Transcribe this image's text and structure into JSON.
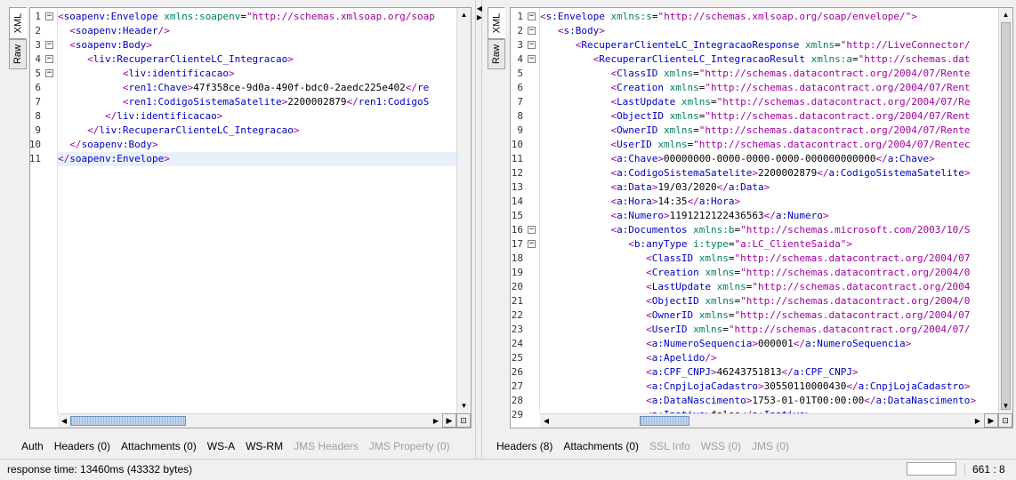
{
  "left": {
    "tabs": [
      "XML",
      "Raw"
    ],
    "active_tab": "XML",
    "lines": [
      {
        "n": "1",
        "fold": "−",
        "indent": 0,
        "seg": [
          [
            "br",
            "<"
          ],
          [
            "tag",
            "soapenv:Envelope"
          ],
          [
            "text",
            " "
          ],
          [
            "attr",
            "xmlns:soapenv"
          ],
          [
            "text",
            "="
          ],
          [
            "val",
            "\"http://schemas.xmlsoap.org/soap"
          ]
        ]
      },
      {
        "n": "2",
        "indent": 2,
        "seg": [
          [
            "br",
            "<"
          ],
          [
            "tag",
            "soapenv:Header"
          ],
          [
            "br",
            "/>"
          ]
        ]
      },
      {
        "n": "3",
        "fold": "−",
        "indent": 2,
        "seg": [
          [
            "br",
            "<"
          ],
          [
            "tag",
            "soapenv:Body"
          ],
          [
            "br",
            ">"
          ]
        ]
      },
      {
        "n": "4",
        "fold": "−",
        "indent": 5,
        "seg": [
          [
            "br",
            "<"
          ],
          [
            "tag",
            "liv:RecuperarClienteLC_Integracao"
          ],
          [
            "br",
            ">"
          ]
        ]
      },
      {
        "n": "5",
        "fold": "−",
        "indent": 11,
        "seg": [
          [
            "br",
            "<"
          ],
          [
            "tag",
            "liv:identificacao"
          ],
          [
            "br",
            ">"
          ]
        ]
      },
      {
        "n": "6",
        "indent": 11,
        "seg": [
          [
            "br",
            "<"
          ],
          [
            "tag",
            "ren1:Chave"
          ],
          [
            "br",
            ">"
          ],
          [
            "text",
            "47f358ce-9d0a-490f-bdc0-2aedc225e402"
          ],
          [
            "br",
            "</"
          ],
          [
            "tag",
            "re"
          ]
        ]
      },
      {
        "n": "7",
        "indent": 11,
        "seg": [
          [
            "br",
            "<"
          ],
          [
            "tag",
            "ren1:CodigoSistemaSatelite"
          ],
          [
            "br",
            ">"
          ],
          [
            "text",
            "2200002879"
          ],
          [
            "br",
            "</"
          ],
          [
            "tag",
            "ren1:CodigoS"
          ]
        ]
      },
      {
        "n": "8",
        "indent": 8,
        "seg": [
          [
            "br",
            "</"
          ],
          [
            "tag",
            "liv:identificacao"
          ],
          [
            "br",
            ">"
          ]
        ]
      },
      {
        "n": "9",
        "indent": 5,
        "seg": [
          [
            "br",
            "</"
          ],
          [
            "tag",
            "liv:RecuperarClienteLC_Integracao"
          ],
          [
            "br",
            ">"
          ]
        ]
      },
      {
        "n": "10",
        "indent": 2,
        "seg": [
          [
            "br",
            "</"
          ],
          [
            "tag",
            "soapenv:Body"
          ],
          [
            "br",
            ">"
          ]
        ]
      },
      {
        "n": "11",
        "indent": 0,
        "current": true,
        "seg": [
          [
            "br",
            "</"
          ],
          [
            "tag",
            "soapenv:Envelope"
          ],
          [
            "br",
            ">"
          ]
        ]
      }
    ],
    "bottom_tabs": [
      {
        "label": "Auth",
        "enabled": true
      },
      {
        "label": "Headers (0)",
        "enabled": true
      },
      {
        "label": "Attachments (0)",
        "enabled": true
      },
      {
        "label": "WS-A",
        "enabled": true
      },
      {
        "label": "WS-RM",
        "enabled": true
      },
      {
        "label": "JMS Headers",
        "enabled": false
      },
      {
        "label": "JMS Property (0)",
        "enabled": false
      }
    ]
  },
  "right": {
    "tabs": [
      "XML",
      "Raw"
    ],
    "active_tab": "XML",
    "lines": [
      {
        "n": "1",
        "fold": "−",
        "indent": 0,
        "seg": [
          [
            "br",
            "<"
          ],
          [
            "tag",
            "s:Envelope"
          ],
          [
            "text",
            " "
          ],
          [
            "attr",
            "xmlns:s"
          ],
          [
            "text",
            "="
          ],
          [
            "val",
            "\"http://schemas.xmlsoap.org/soap/envelope/\">"
          ]
        ]
      },
      {
        "n": "2",
        "fold": "−",
        "indent": 3,
        "seg": [
          [
            "br",
            "<"
          ],
          [
            "tag",
            "s:Body"
          ],
          [
            "br",
            ">"
          ]
        ]
      },
      {
        "n": "3",
        "fold": "−",
        "indent": 6,
        "seg": [
          [
            "br",
            "<"
          ],
          [
            "tag",
            "RecuperarClienteLC_IntegracaoResponse"
          ],
          [
            "text",
            " "
          ],
          [
            "attr",
            "xmlns"
          ],
          [
            "text",
            "="
          ],
          [
            "val",
            "\"http://LiveConnector/"
          ]
        ]
      },
      {
        "n": "4",
        "fold": "−",
        "indent": 9,
        "seg": [
          [
            "br",
            "<"
          ],
          [
            "tag",
            "RecuperarClienteLC_IntegracaoResult"
          ],
          [
            "text",
            " "
          ],
          [
            "attr",
            "xmlns:a"
          ],
          [
            "text",
            "="
          ],
          [
            "val",
            "\"http://schemas.dat"
          ]
        ]
      },
      {
        "n": "5",
        "indent": 12,
        "seg": [
          [
            "br",
            "<"
          ],
          [
            "tag",
            "ClassID"
          ],
          [
            "text",
            " "
          ],
          [
            "attr",
            "xmlns"
          ],
          [
            "text",
            "="
          ],
          [
            "val",
            "\"http://schemas.datacontract.org/2004/07/Rente"
          ]
        ]
      },
      {
        "n": "6",
        "indent": 12,
        "seg": [
          [
            "br",
            "<"
          ],
          [
            "tag",
            "Creation"
          ],
          [
            "text",
            " "
          ],
          [
            "attr",
            "xmlns"
          ],
          [
            "text",
            "="
          ],
          [
            "val",
            "\"http://schemas.datacontract.org/2004/07/Rent"
          ]
        ]
      },
      {
        "n": "7",
        "indent": 12,
        "seg": [
          [
            "br",
            "<"
          ],
          [
            "tag",
            "LastUpdate"
          ],
          [
            "text",
            " "
          ],
          [
            "attr",
            "xmlns"
          ],
          [
            "text",
            "="
          ],
          [
            "val",
            "\"http://schemas.datacontract.org/2004/07/Re"
          ]
        ]
      },
      {
        "n": "8",
        "indent": 12,
        "seg": [
          [
            "br",
            "<"
          ],
          [
            "tag",
            "ObjectID"
          ],
          [
            "text",
            " "
          ],
          [
            "attr",
            "xmlns"
          ],
          [
            "text",
            "="
          ],
          [
            "val",
            "\"http://schemas.datacontract.org/2004/07/Rent"
          ]
        ]
      },
      {
        "n": "9",
        "indent": 12,
        "seg": [
          [
            "br",
            "<"
          ],
          [
            "tag",
            "OwnerID"
          ],
          [
            "text",
            " "
          ],
          [
            "attr",
            "xmlns"
          ],
          [
            "text",
            "="
          ],
          [
            "val",
            "\"http://schemas.datacontract.org/2004/07/Rente"
          ]
        ]
      },
      {
        "n": "10",
        "indent": 12,
        "seg": [
          [
            "br",
            "<"
          ],
          [
            "tag",
            "UserID"
          ],
          [
            "text",
            " "
          ],
          [
            "attr",
            "xmlns"
          ],
          [
            "text",
            "="
          ],
          [
            "val",
            "\"http://schemas.datacontract.org/2004/07/Rentec"
          ]
        ]
      },
      {
        "n": "11",
        "indent": 12,
        "seg": [
          [
            "br",
            "<"
          ],
          [
            "tag",
            "a:Chave"
          ],
          [
            "br",
            ">"
          ],
          [
            "text",
            "00000000-0000-0000-0000-000000000000"
          ],
          [
            "br",
            "</"
          ],
          [
            "tag",
            "a:Chave"
          ],
          [
            "br",
            ">"
          ]
        ]
      },
      {
        "n": "12",
        "indent": 12,
        "seg": [
          [
            "br",
            "<"
          ],
          [
            "tag",
            "a:CodigoSistemaSatelite"
          ],
          [
            "br",
            ">"
          ],
          [
            "text",
            "2200002879"
          ],
          [
            "br",
            "</"
          ],
          [
            "tag",
            "a:CodigoSistemaSatelite"
          ],
          [
            "br",
            ">"
          ]
        ]
      },
      {
        "n": "13",
        "indent": 12,
        "seg": [
          [
            "br",
            "<"
          ],
          [
            "tag",
            "a:Data"
          ],
          [
            "br",
            ">"
          ],
          [
            "text",
            "19/03/2020"
          ],
          [
            "br",
            "</"
          ],
          [
            "tag",
            "a:Data"
          ],
          [
            "br",
            ">"
          ]
        ]
      },
      {
        "n": "14",
        "indent": 12,
        "seg": [
          [
            "br",
            "<"
          ],
          [
            "tag",
            "a:Hora"
          ],
          [
            "br",
            ">"
          ],
          [
            "text",
            "14:35"
          ],
          [
            "br",
            "</"
          ],
          [
            "tag",
            "a:Hora"
          ],
          [
            "br",
            ">"
          ]
        ]
      },
      {
        "n": "15",
        "indent": 12,
        "seg": [
          [
            "br",
            "<"
          ],
          [
            "tag",
            "a:Numero"
          ],
          [
            "br",
            ">"
          ],
          [
            "text",
            "1191212122436563"
          ],
          [
            "br",
            "</"
          ],
          [
            "tag",
            "a:Numero"
          ],
          [
            "br",
            ">"
          ]
        ]
      },
      {
        "n": "16",
        "fold": "−",
        "indent": 12,
        "seg": [
          [
            "br",
            "<"
          ],
          [
            "tag",
            "a:Documentos"
          ],
          [
            "text",
            " "
          ],
          [
            "attr",
            "xmlns:b"
          ],
          [
            "text",
            "="
          ],
          [
            "val",
            "\"http://schemas.microsoft.com/2003/10/S"
          ]
        ]
      },
      {
        "n": "17",
        "fold": "−",
        "indent": 15,
        "seg": [
          [
            "br",
            "<"
          ],
          [
            "tag",
            "b:anyType"
          ],
          [
            "text",
            " "
          ],
          [
            "attr",
            "i:type"
          ],
          [
            "text",
            "="
          ],
          [
            "val",
            "\"a:LC_ClienteSaida\">"
          ]
        ]
      },
      {
        "n": "18",
        "indent": 18,
        "seg": [
          [
            "br",
            "<"
          ],
          [
            "tag",
            "ClassID"
          ],
          [
            "text",
            " "
          ],
          [
            "attr",
            "xmlns"
          ],
          [
            "text",
            "="
          ],
          [
            "val",
            "\"http://schemas.datacontract.org/2004/07"
          ]
        ]
      },
      {
        "n": "19",
        "indent": 18,
        "seg": [
          [
            "br",
            "<"
          ],
          [
            "tag",
            "Creation"
          ],
          [
            "text",
            " "
          ],
          [
            "attr",
            "xmlns"
          ],
          [
            "text",
            "="
          ],
          [
            "val",
            "\"http://schemas.datacontract.org/2004/0"
          ]
        ]
      },
      {
        "n": "20",
        "indent": 18,
        "seg": [
          [
            "br",
            "<"
          ],
          [
            "tag",
            "LastUpdate"
          ],
          [
            "text",
            " "
          ],
          [
            "attr",
            "xmlns"
          ],
          [
            "text",
            "="
          ],
          [
            "val",
            "\"http://schemas.datacontract.org/2004"
          ]
        ]
      },
      {
        "n": "21",
        "indent": 18,
        "seg": [
          [
            "br",
            "<"
          ],
          [
            "tag",
            "ObjectID"
          ],
          [
            "text",
            " "
          ],
          [
            "attr",
            "xmlns"
          ],
          [
            "text",
            "="
          ],
          [
            "val",
            "\"http://schemas.datacontract.org/2004/0"
          ]
        ]
      },
      {
        "n": "22",
        "indent": 18,
        "seg": [
          [
            "br",
            "<"
          ],
          [
            "tag",
            "OwnerID"
          ],
          [
            "text",
            " "
          ],
          [
            "attr",
            "xmlns"
          ],
          [
            "text",
            "="
          ],
          [
            "val",
            "\"http://schemas.datacontract.org/2004/07"
          ]
        ]
      },
      {
        "n": "23",
        "indent": 18,
        "seg": [
          [
            "br",
            "<"
          ],
          [
            "tag",
            "UserID"
          ],
          [
            "text",
            " "
          ],
          [
            "attr",
            "xmlns"
          ],
          [
            "text",
            "="
          ],
          [
            "val",
            "\"http://schemas.datacontract.org/2004/07/"
          ]
        ]
      },
      {
        "n": "24",
        "indent": 18,
        "seg": [
          [
            "br",
            "<"
          ],
          [
            "tag",
            "a:NumeroSequencia"
          ],
          [
            "br",
            ">"
          ],
          [
            "text",
            "000001"
          ],
          [
            "br",
            "</"
          ],
          [
            "tag",
            "a:NumeroSequencia"
          ],
          [
            "br",
            ">"
          ]
        ]
      },
      {
        "n": "25",
        "indent": 18,
        "seg": [
          [
            "br",
            "<"
          ],
          [
            "tag",
            "a:Apelido"
          ],
          [
            "br",
            "/>"
          ]
        ]
      },
      {
        "n": "26",
        "indent": 18,
        "seg": [
          [
            "br",
            "<"
          ],
          [
            "tag",
            "a:CPF_CNPJ"
          ],
          [
            "br",
            ">"
          ],
          [
            "text",
            "46243751813"
          ],
          [
            "br",
            "</"
          ],
          [
            "tag",
            "a:CPF_CNPJ"
          ],
          [
            "br",
            ">"
          ]
        ]
      },
      {
        "n": "27",
        "indent": 18,
        "seg": [
          [
            "br",
            "<"
          ],
          [
            "tag",
            "a:CnpjLojaCadastro"
          ],
          [
            "br",
            ">"
          ],
          [
            "text",
            "30550110000430"
          ],
          [
            "br",
            "</"
          ],
          [
            "tag",
            "a:CnpjLojaCadastro"
          ],
          [
            "br",
            ">"
          ]
        ]
      },
      {
        "n": "28",
        "indent": 18,
        "seg": [
          [
            "br",
            "<"
          ],
          [
            "tag",
            "a:DataNascimento"
          ],
          [
            "br",
            ">"
          ],
          [
            "text",
            "1753-01-01T00:00:00"
          ],
          [
            "br",
            "</"
          ],
          [
            "tag",
            "a:DataNascimento"
          ],
          [
            "br",
            ">"
          ]
        ]
      },
      {
        "n": "29",
        "indent": 18,
        "seg": [
          [
            "br",
            "<"
          ],
          [
            "tag",
            "a:Inativo"
          ],
          [
            "br",
            ">"
          ],
          [
            "text",
            "false"
          ],
          [
            "br",
            "</"
          ],
          [
            "tag",
            "a:Inativo"
          ],
          [
            "br",
            ">"
          ]
        ]
      }
    ],
    "bottom_tabs": [
      {
        "label": "Headers (8)",
        "enabled": true
      },
      {
        "label": "Attachments (0)",
        "enabled": true
      },
      {
        "label": "SSL Info",
        "enabled": false
      },
      {
        "label": "WSS (0)",
        "enabled": false
      },
      {
        "label": "JMS (0)",
        "enabled": false
      }
    ]
  },
  "status": {
    "response_time": "response time: 13460ms (43332 bytes)",
    "cursor_pos": "661 : 8"
  },
  "icons": {
    "fold": "minus-box-icon",
    "scroll_up": "▲",
    "scroll_down": "▼",
    "scroll_left": "◀",
    "scroll_right": "▶",
    "corner": "magnify-icon"
  }
}
